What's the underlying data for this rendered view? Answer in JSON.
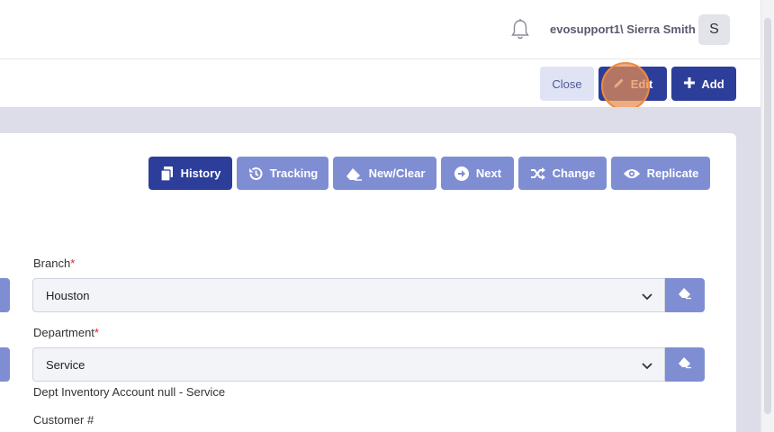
{
  "header": {
    "user_label": "evosupport1\\ Sierra Smith",
    "avatar_initial": "S",
    "icons": {
      "notifications": "bell-icon"
    }
  },
  "actions": {
    "close_label": "Close",
    "edit_label": "Edit",
    "add_label": "Add"
  },
  "toolbar": [
    {
      "label": "History",
      "icon": "copy-icon",
      "active": true
    },
    {
      "label": "Tracking",
      "icon": "history-icon",
      "active": false
    },
    {
      "label": "New/Clear",
      "icon": "eraser-icon",
      "active": false
    },
    {
      "label": "Next",
      "icon": "arrow-right-circle-icon",
      "active": false
    },
    {
      "label": "Change",
      "icon": "shuffle-icon",
      "active": false
    },
    {
      "label": "Replicate",
      "icon": "eye-icon",
      "active": false
    }
  ],
  "form": {
    "branch": {
      "label": "Branch",
      "required_mark": "*",
      "value": "Houston"
    },
    "department": {
      "label": "Department",
      "required_mark": "*",
      "value": "Service",
      "helper": "Dept Inventory Account null - Service"
    },
    "customer": {
      "label": "Customer #"
    }
  },
  "colors": {
    "primary": "#2d3e9a",
    "secondary": "#7f8ed3",
    "required": "#d9232e"
  }
}
